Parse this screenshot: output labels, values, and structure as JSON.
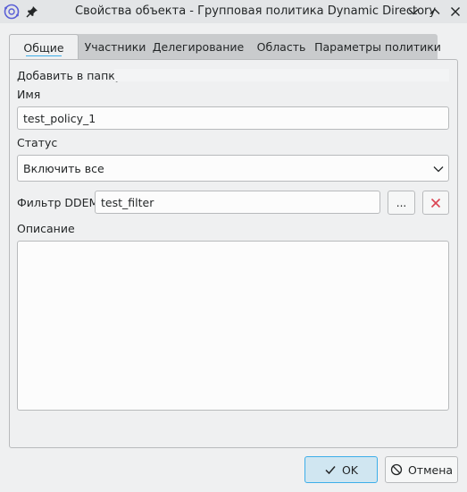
{
  "window": {
    "title": "Свойства объекта - Групповая политика Dynamic Directory",
    "icons": {
      "app": "dynamic-directory-icon",
      "pin": "pin-icon",
      "minimize": "chevron-down-icon",
      "maximize": "chevron-up-icon",
      "close": "close-icon"
    }
  },
  "tabs": [
    {
      "label": "Общие",
      "active": true
    },
    {
      "label": "Участники",
      "active": false
    },
    {
      "label": "Делегирование",
      "active": false
    },
    {
      "label": "Область",
      "active": false
    },
    {
      "label": "Параметры политики",
      "active": false
    }
  ],
  "form": {
    "add_to_folder_label": "Добавить в папку",
    "name_label": "Имя",
    "name_value": "test_policy_1",
    "status_label": "Статус",
    "status_value": "Включить все",
    "filter_label": "Фильтр DDEM",
    "filter_value": "test_filter",
    "browse_label": "...",
    "description_label": "Описание",
    "description_value": ""
  },
  "buttons": {
    "ok_label": "OK",
    "cancel_label": "Отмена"
  },
  "colors": {
    "accent": "#3daee9",
    "clear_red": "#da4453"
  }
}
